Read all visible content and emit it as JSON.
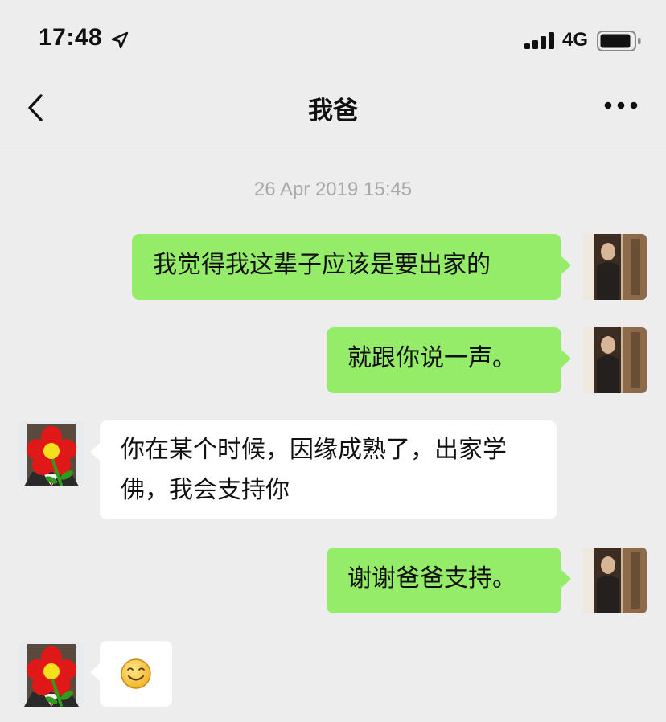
{
  "status_bar": {
    "time": "17:48",
    "network": "4G",
    "icons": [
      "location-arrow-icon",
      "signal-bars-icon",
      "battery-icon"
    ]
  },
  "header": {
    "title": "我爸",
    "back_icon": "chevron-left-icon",
    "more_icon": "more-dots-icon"
  },
  "chat": {
    "timestamp": "26 Apr 2019 15:45",
    "messages": [
      {
        "sender": "me",
        "text": "我觉得我这辈子应该是要出家的"
      },
      {
        "sender": "me",
        "text": "就跟你说一声。"
      },
      {
        "sender": "dad",
        "text": "你在某个时候，因缘成熟了，出家学佛，我会支持你"
      },
      {
        "sender": "me",
        "text": "谢谢爸爸支持。"
      },
      {
        "sender": "dad",
        "text": "",
        "emoji": "smiley-face-emoji"
      }
    ]
  },
  "colors": {
    "background": "#ededed",
    "outgoing_bubble": "#95ec69",
    "incoming_bubble": "#ffffff",
    "timestamp_text": "#a9a9a9"
  }
}
